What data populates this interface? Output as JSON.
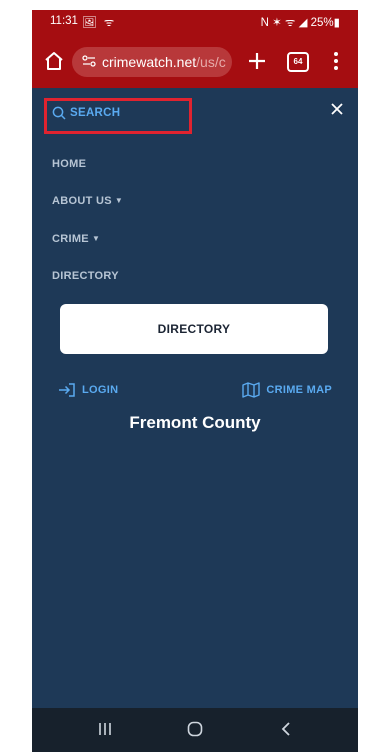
{
  "status_bar": {
    "time": "11:31",
    "left_icons": "🖼 ᯤ",
    "right_text": "N ✶ ᯤ ◢ 25%▮"
  },
  "browser": {
    "url_host": "crimewatch.net",
    "url_path": "/us/c",
    "tab_count": "64"
  },
  "nav": {
    "search_label": "SEARCH",
    "items": [
      {
        "label": "HOME",
        "has_caret": false
      },
      {
        "label": "ABOUT US",
        "has_caret": true
      },
      {
        "label": "CRIME",
        "has_caret": true
      },
      {
        "label": "DIRECTORY",
        "has_caret": false
      }
    ],
    "caret_glyph": "▼",
    "directory_button": "DIRECTORY",
    "login_label": "LOGIN",
    "crime_map_label": "CRIME MAP",
    "county": "Fremont County"
  },
  "colors": {
    "browser_chrome": "#a50d11",
    "page_background": "#1e3957",
    "link_blue": "#5aaaf0",
    "highlight_red": "#e0232f"
  }
}
